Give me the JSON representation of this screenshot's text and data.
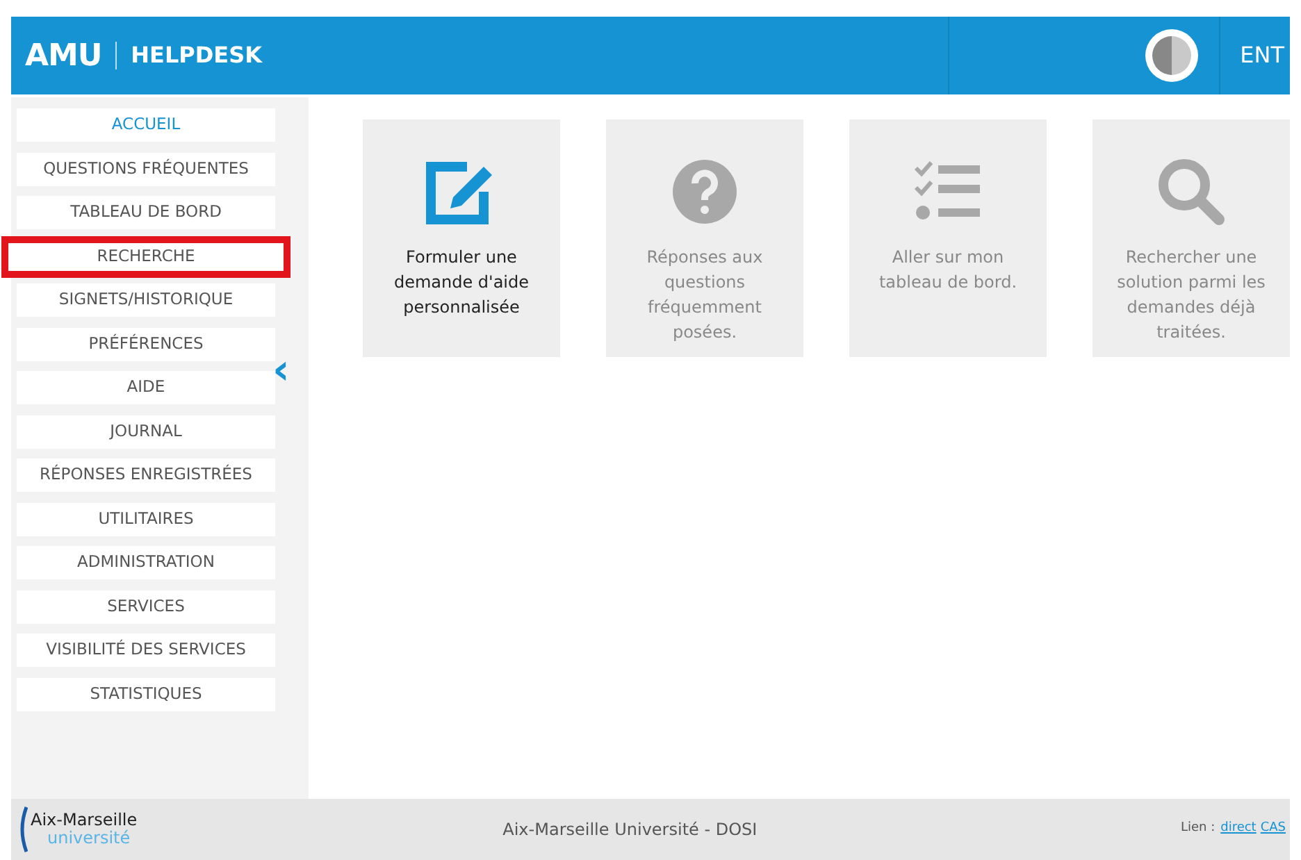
{
  "header": {
    "logo": "AMU",
    "title": "HELPDESK",
    "ent_label": "ENT"
  },
  "sidebar": {
    "items": [
      {
        "label": "ACCUEIL",
        "selected": true,
        "outlined": false
      },
      {
        "label": "QUESTIONS FRÉQUENTES",
        "selected": false,
        "outlined": false
      },
      {
        "label": "TABLEAU DE BORD",
        "selected": false,
        "outlined": false
      },
      {
        "label": "RECHERCHE",
        "selected": false,
        "outlined": true
      },
      {
        "label": "SIGNETS/HISTORIQUE",
        "selected": false,
        "outlined": false
      },
      {
        "label": "PRÉFÉRENCES",
        "selected": false,
        "outlined": false
      },
      {
        "label": "AIDE",
        "selected": false,
        "outlined": false
      },
      {
        "label": "JOURNAL",
        "selected": false,
        "outlined": false
      },
      {
        "label": "RÉPONSES ENREGISTRÉES",
        "selected": false,
        "outlined": false
      },
      {
        "label": "UTILITAIRES",
        "selected": false,
        "outlined": false
      },
      {
        "label": "ADMINISTRATION",
        "selected": false,
        "outlined": false
      },
      {
        "label": "SERVICES",
        "selected": false,
        "outlined": false
      },
      {
        "label": "VISIBILITÉ DES SERVICES",
        "selected": false,
        "outlined": false
      },
      {
        "label": "STATISTIQUES",
        "selected": false,
        "outlined": false
      }
    ],
    "collapse_toggle": "‹"
  },
  "cards": [
    {
      "kind": "edit",
      "text": "Formuler une demande d'aide personnalisée",
      "active": true
    },
    {
      "kind": "help",
      "text": "Réponses aux questions fréquemment posées.",
      "active": false
    },
    {
      "kind": "checklist",
      "text": "Aller sur mon tableau de bord.",
      "active": false
    },
    {
      "kind": "search",
      "text": "Rechercher une solution parmi les demandes déjà traitées.",
      "active": false
    }
  ],
  "footer": {
    "logo_top": "Aix-Marseille",
    "logo_bottom": "université",
    "center": "Aix-Marseille Université - DOSI",
    "link_label": "Lien :",
    "links": [
      "direct",
      "CAS"
    ]
  }
}
